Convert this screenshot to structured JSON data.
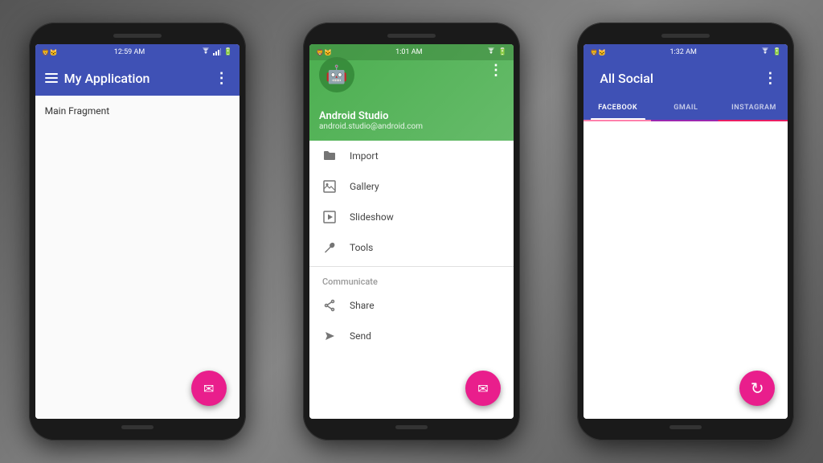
{
  "phone1": {
    "statusBar": {
      "left": "🦁 🐱",
      "time": "12:59 AM",
      "icons": "📶🔋"
    },
    "appBar": {
      "title": "My Application",
      "menuLabel": "⋮"
    },
    "content": {
      "fragmentLabel": "Main Fragment"
    },
    "fab": {
      "icon": "✉",
      "ariaLabel": "compose-email"
    }
  },
  "phone2": {
    "statusBar": {
      "left": "🦁 🐱",
      "time": "1:01 AM",
      "icons": "📶🔋"
    },
    "appBar": {
      "menuLabel": "⋮"
    },
    "drawer": {
      "name": "Android Studio",
      "email": "android.studio@android.com",
      "items": [
        {
          "label": "Import",
          "icon": "folder"
        },
        {
          "label": "Gallery",
          "icon": "image"
        },
        {
          "label": "Slideshow",
          "icon": "play"
        },
        {
          "label": "Tools",
          "icon": "wrench"
        }
      ],
      "sectionLabel": "Communicate",
      "communicateItems": [
        {
          "label": "Share",
          "icon": "share"
        },
        {
          "label": "Send",
          "icon": "send"
        }
      ]
    },
    "fab": {
      "icon": "✉",
      "ariaLabel": "compose-email"
    }
  },
  "phone3": {
    "statusBar": {
      "left": "🦁 🐱",
      "time": "1:32 AM",
      "icons": "📶🔋"
    },
    "appBar": {
      "title": "All Social",
      "menuLabel": "⋮"
    },
    "tabs": [
      {
        "label": "FACEBOOK",
        "active": true
      },
      {
        "label": "GMAIL",
        "active": false
      },
      {
        "label": "INSTAGRAM",
        "active": false
      }
    ],
    "fab": {
      "icon": "↻",
      "ariaLabel": "refresh"
    }
  }
}
